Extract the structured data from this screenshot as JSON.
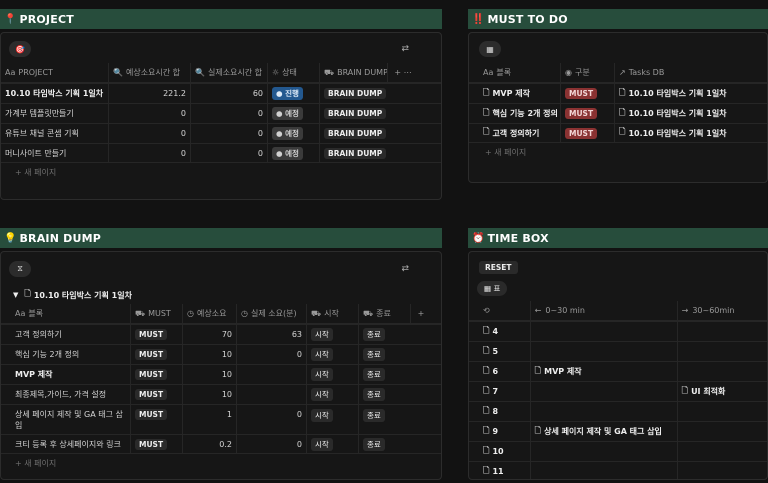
{
  "project": {
    "icon": "📍",
    "title": "PROJECT",
    "view_icon": "🎯",
    "columns": {
      "name": "PROJECT",
      "est": "예상소요시간 합",
      "actual": "실제소요시간 합",
      "status": "상태",
      "dump": "BRAIN DUMP"
    },
    "rows": [
      {
        "name": "10.10 타임박스 기획 1일차",
        "est": "221.2",
        "actual": "60",
        "status": "진행",
        "dump": "BRAIN DUMP"
      },
      {
        "name": "가계부 템플릿만들기",
        "est": "0",
        "actual": "0",
        "status": "예정",
        "dump": "BRAIN DUMP"
      },
      {
        "name": "유튜브 채널 콘셉 기획",
        "est": "0",
        "actual": "0",
        "status": "예정",
        "dump": "BRAIN DUMP"
      },
      {
        "name": "머니사이트 만들기",
        "est": "0",
        "actual": "0",
        "status": "예정",
        "dump": "BRAIN DUMP"
      }
    ],
    "new_page": "+ 새 페이지"
  },
  "must": {
    "icon": "‼️",
    "title": "MUST TO DO",
    "columns": {
      "name": "블록",
      "type": "구분",
      "db": "Tasks DB"
    },
    "rows": [
      {
        "name": "MVP 제작",
        "type": "MUST",
        "db": "10.10 타임박스 기획 1일차"
      },
      {
        "name": "핵심 기능 2개 정의",
        "type": "MUST",
        "db": "10.10 타임박스 기획 1일차"
      },
      {
        "name": "고객 정의하기",
        "type": "MUST",
        "db": "10.10 타임박스 기획 1일차"
      }
    ],
    "new_page": "+ 새 페이지"
  },
  "brain": {
    "icon": "💡",
    "title": "BRAIN DUMP",
    "group": "10.10 타임박스 기획 1일차",
    "columns": {
      "name": "블록",
      "must": "MUST",
      "est": "예상소요",
      "actual": "실제 소요(분)",
      "start": "시작",
      "end": "종료"
    },
    "rows": [
      {
        "name": "고객 정의하기",
        "must": "MUST",
        "est": "70",
        "actual": "63",
        "start": "시작",
        "end": "종료"
      },
      {
        "name": "핵심 기능 2개 정의",
        "must": "MUST",
        "est": "10",
        "actual": "0",
        "start": "시작",
        "end": "종료"
      },
      {
        "name": "MVP 제작",
        "must": "MUST",
        "est": "10",
        "actual": "",
        "start": "시작",
        "end": "종료"
      },
      {
        "name": "최종제목,가이드, 가격 설정",
        "must": "MUST",
        "est": "10",
        "actual": "",
        "start": "시작",
        "end": "종료"
      },
      {
        "name": "상세 페이지 제작 및 GA 태그 삽입",
        "must": "MUST",
        "est": "1",
        "actual": "0",
        "start": "시작",
        "end": "종료"
      },
      {
        "name": "크티 등록 후 상세페이지와 링크",
        "must": "MUST",
        "est": "0.2",
        "actual": "0",
        "start": "시작",
        "end": "종료"
      }
    ],
    "new_page": "+ 새 페이지"
  },
  "timebox": {
    "icon": "⏰",
    "title": "TIME BOX",
    "reset": "RESET",
    "view": "표",
    "col1": "0~30 min",
    "col2": "30~60min",
    "rows": [
      {
        "hour": "4",
        "a": "",
        "b": ""
      },
      {
        "hour": "5",
        "a": "",
        "b": ""
      },
      {
        "hour": "6",
        "a": "MVP 제작",
        "b": ""
      },
      {
        "hour": "7",
        "a": "",
        "b": "UI 최적화"
      },
      {
        "hour": "8",
        "a": "",
        "b": ""
      },
      {
        "hour": "9",
        "a": "상세 페이지 제작 및 GA 태그 삽입",
        "b": ""
      },
      {
        "hour": "10",
        "a": "",
        "b": ""
      },
      {
        "hour": "11",
        "a": "",
        "b": ""
      }
    ]
  }
}
